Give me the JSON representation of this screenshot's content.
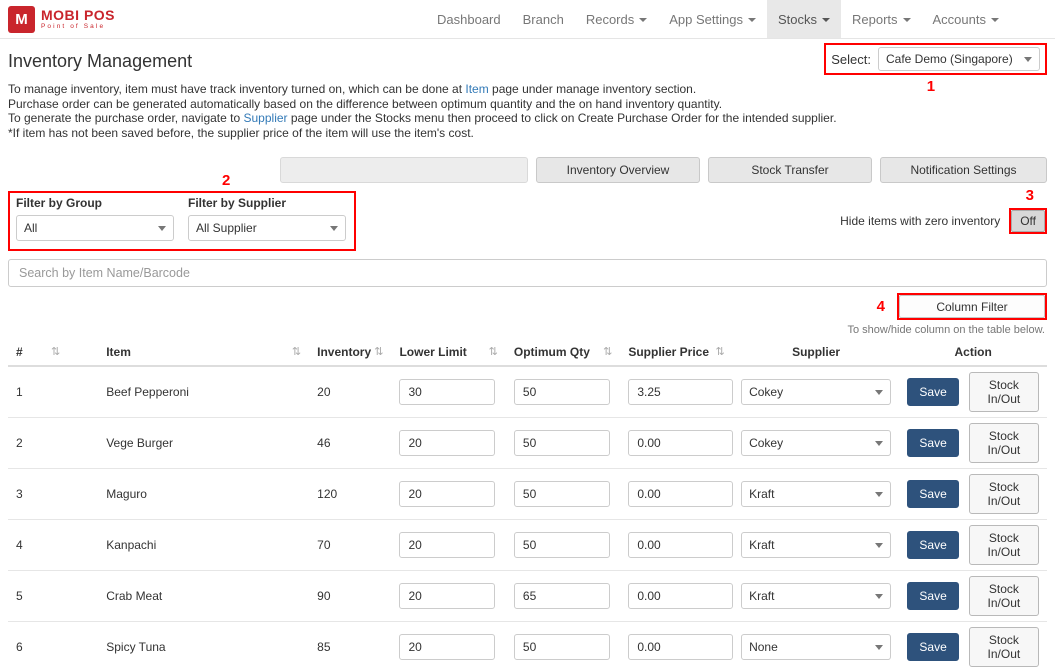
{
  "brand": {
    "logo_letter": "M",
    "name": "MOBI POS",
    "subtitle": "Point of Sale"
  },
  "nav": {
    "items": [
      {
        "label": "Dashboard",
        "dropdown": false,
        "active": false
      },
      {
        "label": "Branch",
        "dropdown": false,
        "active": false
      },
      {
        "label": "Records",
        "dropdown": true,
        "active": false
      },
      {
        "label": "App Settings",
        "dropdown": true,
        "active": false
      },
      {
        "label": "Stocks",
        "dropdown": true,
        "active": true
      },
      {
        "label": "Reports",
        "dropdown": true,
        "active": false
      },
      {
        "label": "Accounts",
        "dropdown": true,
        "active": false
      }
    ]
  },
  "page": {
    "title": "Inventory Management"
  },
  "branch_select": {
    "label": "Select:",
    "value": "Cafe Demo (Singapore)"
  },
  "annotations": {
    "n1": "1",
    "n2": "2",
    "n3": "3",
    "n4": "4"
  },
  "description": [
    {
      "pre": "To manage inventory, item must have track inventory turned on, which can be done at ",
      "link": "Item",
      "post": " page under manage inventory section."
    },
    {
      "pre": "Purchase order can be generated automatically based on the difference between optimum quantity and the on hand inventory quantity.",
      "link": "",
      "post": ""
    },
    {
      "pre": "To generate the purchase order, navigate to ",
      "link": "Supplier",
      "post": " page under the Stocks menu then proceed to click on Create Purchase Order for the intended supplier."
    },
    {
      "pre": "*If item has not been saved before, the supplier price of the item will use the item's cost.",
      "link": "",
      "post": ""
    }
  ],
  "toolbar": {
    "buttons": [
      {
        "label": "",
        "disabled": true
      },
      {
        "label": "Inventory Overview",
        "disabled": false
      },
      {
        "label": "Stock Transfer",
        "disabled": false
      },
      {
        "label": "Notification Settings",
        "disabled": false
      }
    ]
  },
  "filters": {
    "group": {
      "label": "Filter by Group",
      "value": "All"
    },
    "supplier": {
      "label": "Filter by Supplier",
      "value": "All Supplier"
    },
    "zero_inventory_label": "Hide items with zero inventory",
    "zero_inventory_toggle": "Off"
  },
  "search": {
    "placeholder": "Search by Item Name/Barcode"
  },
  "column_filter": {
    "button_label": "Column Filter",
    "hint": "To show/hide column on the table below."
  },
  "icons": {
    "sort": "⇅"
  },
  "table": {
    "headers": [
      {
        "label": "#",
        "sortable": true,
        "align": "left"
      },
      {
        "label": "Item",
        "sortable": true,
        "align": "left"
      },
      {
        "label": "Inventory",
        "sortable": true,
        "align": "left"
      },
      {
        "label": "Lower Limit",
        "sortable": true,
        "align": "left"
      },
      {
        "label": "Optimum Qty",
        "sortable": true,
        "align": "left"
      },
      {
        "label": "Supplier Price",
        "sortable": true,
        "align": "left"
      },
      {
        "label": "Supplier",
        "sortable": false,
        "align": "center"
      },
      {
        "label": "Action",
        "sortable": false,
        "align": "center"
      }
    ],
    "save_label": "Save",
    "stock_label": "Stock In/Out",
    "rows": [
      {
        "num": "1",
        "item": "Beef Pepperoni",
        "inventory": "20",
        "lower_limit": "30",
        "optimum_qty": "50",
        "supplier_price": "3.25",
        "supplier": "Cokey"
      },
      {
        "num": "2",
        "item": "Vege Burger",
        "inventory": "46",
        "lower_limit": "20",
        "optimum_qty": "50",
        "supplier_price": "0.00",
        "supplier": "Cokey"
      },
      {
        "num": "3",
        "item": "Maguro",
        "inventory": "120",
        "lower_limit": "20",
        "optimum_qty": "50",
        "supplier_price": "0.00",
        "supplier": "Kraft"
      },
      {
        "num": "4",
        "item": "Kanpachi",
        "inventory": "70",
        "lower_limit": "20",
        "optimum_qty": "50",
        "supplier_price": "0.00",
        "supplier": "Kraft"
      },
      {
        "num": "5",
        "item": "Crab Meat",
        "inventory": "90",
        "lower_limit": "20",
        "optimum_qty": "65",
        "supplier_price": "0.00",
        "supplier": "Kraft"
      },
      {
        "num": "6",
        "item": "Spicy Tuna",
        "inventory": "85",
        "lower_limit": "20",
        "optimum_qty": "50",
        "supplier_price": "0.00",
        "supplier": "None"
      }
    ]
  },
  "colors": {
    "annotation_red": "#ff0000",
    "brand_red": "#c9252c",
    "save_button": "#2e527c",
    "link_blue": "#337ab7"
  }
}
